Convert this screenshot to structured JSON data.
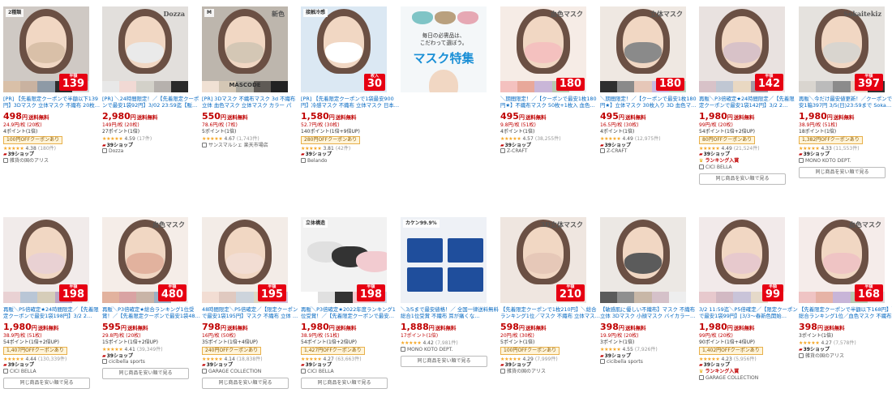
{
  "labels": {
    "ship_free": "送料無料",
    "yen": "円",
    "badge_39": "39ショップ",
    "rank_in": "ランキング入賞",
    "same_button": "同じ商品を安い順で見る"
  },
  "colors": {
    "accent_red": "#bf0000",
    "link_blue": "#0066c0",
    "star": "#f5a623"
  },
  "items": [
    {
      "title": "[PR] 【先着限定クーポンで半額以下139円】3Dマスク 立体マスク 不織布 20枚…",
      "price": "498",
      "unit": "24.9円/枚 (20枚)",
      "points": "4ポイント(1倍)",
      "coupon": "100円OFFクーポンあり",
      "stars": "★★★★★",
      "rating": "4.38",
      "reviews": "(180件)",
      "ship39": true,
      "rank": false,
      "shop": "雑貨の国のアリス",
      "same": false,
      "thumb": {
        "style": "woman",
        "hair": "#5b4034",
        "mask": "#d9c0a8",
        "bg": "#cfc9c4",
        "strip": [
          "#d9c0a8",
          "#c9b2a0",
          "#8e9aa6",
          "#2d2d2d",
          "#d7d7d7"
        ],
        "badge_top": "2種類",
        "brand": "",
        "caption": "",
        "price_badge": "139",
        "price_small": "半額"
      }
    },
    {
      "title": "[PR] ＼24時間限定！／【先着限定クーポンで最安1袋92円】3/02 23:59迄【販…",
      "price": "2,980",
      "unit": "149円/枚 (20枚)",
      "points": "27ポイント(1倍)",
      "coupon": "",
      "stars": "★★★★★",
      "rating": "4.59",
      "reviews": "(17件)",
      "ship39": true,
      "rank": false,
      "shop": "Dozza",
      "same": false,
      "thumb": {
        "style": "woman",
        "hair": "#3b2e2a",
        "mask": "#eaeaea",
        "bg": "#e2dfdc",
        "strip": [
          "#e8e8e8",
          "#f1d9d4",
          "#d3d1c9",
          "#b6b1ad",
          "#2a2a2a"
        ],
        "badge_top": "",
        "brand": "Dozza",
        "caption": "",
        "price_badge": "",
        "price_small": ""
      }
    },
    {
      "title": "[PR] 3Dマスク 不織布マスク 3d 不織布 立体 血色マスク 立体マスク カラー パー…",
      "price": "550",
      "unit": "78.6円/枚 (7枚)",
      "points": "5ポイント(1倍)",
      "coupon": "",
      "stars": "★★★★★",
      "rating": "4.67",
      "reviews": "(1,743件)",
      "ship39": false,
      "rank": false,
      "shop": "サンスマルシェ 楽天市場店",
      "same": false,
      "thumb": {
        "style": "woman",
        "hair": "#2e2320",
        "mask": "#d4c7b5",
        "bg": "#bdb6ad",
        "strip": [
          "#f0e1d4",
          "#d4c7b5",
          "#a7a49b",
          "#5f5a55",
          "#222"
        ],
        "badge_top": "M",
        "brand": "新色",
        "caption": "MASCODE",
        "price_badge": "",
        "price_small": ""
      }
    },
    {
      "title": "[PR] 【先着限定クーポンで1袋最安900円】冷感マスク 不織布 立体マスク 日本…",
      "price": "1,580",
      "unit": "52.7円/枚 (30枚)",
      "points": "140ポイント(1倍+9倍UP)",
      "coupon": "280円OFFクーポンあり",
      "stars": "★★★★★",
      "rating": "3.81",
      "reviews": "(42件)",
      "ship39": true,
      "rank": false,
      "shop": "Belando",
      "same": false,
      "thumb": {
        "style": "woman",
        "hair": "#2b2b2b",
        "mask": "#ffffff",
        "bg": "#dbe8f3",
        "strip": [],
        "badge_top": "接触冷感",
        "brand": "",
        "caption": "",
        "price_badge": "30",
        "price_small": "枚入"
      }
    },
    {
      "title": "",
      "price": "",
      "unit": "",
      "points": "",
      "coupon": "",
      "stars": "",
      "rating": "",
      "reviews": "",
      "ship39": false,
      "rank": false,
      "shop": "",
      "same": false,
      "feature": {
        "sub": "毎日の必需品は、\nこだわって選ぼう。",
        "title": "マスク特集"
      },
      "thumb": {
        "style": "feature",
        "hair": "#3a2e2a",
        "mask": "#ffffff",
        "bg": "#f4f7f9",
        "strip": [],
        "badge_top": "",
        "brand": "",
        "caption": "",
        "price_badge": "",
        "price_small": ""
      }
    },
    {
      "title": "＼期間限定！／【クーポンで最安1枚180円★】不織布マスク 50枚+1枚入 血色…",
      "price": "495",
      "unit": "9.8円/枚 (51枚)",
      "points": "4ポイント(1倍)",
      "coupon": "",
      "stars": "★★★★★",
      "rating": "4.57",
      "reviews": "(38,255件)",
      "ship39": true,
      "rank": false,
      "shop": "Z-CRAFT",
      "same": false,
      "thumb": {
        "style": "woman",
        "hair": "#4a3a32",
        "mask": "#f4c1bf",
        "bg": "#f6ece6",
        "strip": [
          "#f4c1bf",
          "#e8a89a",
          "#c9b6d8",
          "#b8c8b0",
          "#eee"
        ],
        "badge_top": "",
        "brand": "血色マスク",
        "caption": "",
        "price_badge": "180",
        "price_small": ""
      }
    },
    {
      "title": "＼期間限定！／【クーポンで最安1枚180円★】立体マスク 30枚入り 3D 血色マ…",
      "price": "495",
      "unit": "16.5円/枚 (30枚)",
      "points": "4ポイント(1倍)",
      "coupon": "",
      "stars": "★★★★★",
      "rating": "4.49",
      "reviews": "(12,975件)",
      "ship39": true,
      "rank": false,
      "shop": "Z-CRAFT",
      "same": false,
      "thumb": {
        "style": "woman",
        "hair": "#3a2a22",
        "mask": "#8a8a8a",
        "bg": "#efe8e2",
        "strip": [
          "#2f2f2f",
          "#8a8a8a",
          "#e6c7b8",
          "#c7b9e0",
          "#b6d3c2"
        ],
        "badge_top": "",
        "brand": "立体マスク",
        "caption": "",
        "price_badge": "180",
        "price_small": ""
      }
    },
    {
      "title": "再販＼P3倍確定★24時間限定／【先着限定クーポンで最安1袋142円】3/2 2…",
      "price": "1,980",
      "unit": "99円/枚 (20枚)",
      "points": "54ポイント(1倍+2倍UP)",
      "coupon": "80円OFFクーポンあり",
      "stars": "★★★★★",
      "rating": "4.49",
      "reviews": "(21,524件)",
      "ship39": true,
      "rank": true,
      "shop": "CICI BELLA",
      "same": true,
      "thumb": {
        "style": "woman",
        "hair": "#3d2d27",
        "mask": "#d8c2c8",
        "bg": "#e9e2e0",
        "strip": [
          "#d8c2c8",
          "#c0c7d3",
          "#e9d8c2",
          "#a29aa5",
          "#f3e6e6"
        ],
        "badge_top": "",
        "brand": "",
        "caption": "",
        "price_badge": "142",
        "price_small": "半額"
      }
    },
    {
      "title": "再販＼今だけ最安値更新！／クーポンで最安1箱397円 3/5(日)23:59まで Soka…",
      "price": "1,980",
      "unit": "38.9円/枚 (51枚)",
      "points": "18ポイント(1倍)",
      "coupon": "1,382円OFFクーポンあり",
      "stars": "★★★★★",
      "rating": "4.33",
      "reviews": "(11,553件)",
      "ship39": true,
      "rank": false,
      "shop": "MONO KOTO DEPT.",
      "same": true,
      "thumb": {
        "style": "woman",
        "hair": "#2e2622",
        "mask": "#d9d5cf",
        "bg": "#e5e2de",
        "strip": [
          "#d9d5cf",
          "#bbb",
          "#8b8b8b",
          "#e7cfc2",
          "#333"
        ],
        "badge_top": "",
        "brand": "Sokaitekiz",
        "caption": "",
        "price_badge": "397",
        "price_small": "半額"
      }
    },
    {
      "title": "再販＼P5倍確定★24時間限定／【先着限定クーポンで最安1袋198円】3/2 2…",
      "price": "1,980",
      "unit": "38.9円/枚 (51枚)",
      "points": "54ポイント(1倍+2倍UP)",
      "coupon": "1,407円OFFクーポンあり",
      "stars": "★★★★★",
      "rating": "4.44",
      "reviews": "(130,339件)",
      "ship39": true,
      "rank": false,
      "shop": "CICI BELLA",
      "same": true,
      "thumb": {
        "style": "woman",
        "hair": "#3a2a22",
        "mask": "#e9d1d3",
        "bg": "#f1ebea",
        "strip": [
          "#e9d1d3",
          "#b9c6d6",
          "#d6cdb9",
          "#bca6c4",
          "#f0efee"
        ],
        "badge_top": "",
        "brand": "",
        "caption": "",
        "price_badge": "198",
        "price_small": "半額"
      }
    },
    {
      "title": "再販＼P3倍確定★総合ランキング1位受賞！／【先着限定クーポンで最安1袋48…",
      "price": "595",
      "unit": "29.8円/枚 (20枚)",
      "points": "15ポイント(1倍+2倍UP)",
      "coupon": "",
      "stars": "★★★★★",
      "rating": "4.41",
      "reviews": "(39,349件)",
      "ship39": true,
      "rank": false,
      "shop": "cicibella sports",
      "same": true,
      "thumb": {
        "style": "woman",
        "hair": "#4a3a32",
        "mask": "#e2b29e",
        "bg": "#f5ede8",
        "strip": [
          "#e2b29e",
          "#d9a3a3",
          "#c9b4a7",
          "#9bb0c4",
          "#eee"
        ],
        "badge_top": "",
        "brand": "血色マスク",
        "caption": "",
        "price_badge": "480",
        "price_small": "半額"
      }
    },
    {
      "title": "48時間限定＼P5倍確定／【限定クーポンで最安1袋195円】マスク 不織布 立体 …",
      "price": "798",
      "unit": "16円/枚 (50枚)",
      "points": "35ポイント(1倍+4倍UP)",
      "coupon": "240円OFFクーポンあり",
      "stars": "★★★★★",
      "rating": "4.14",
      "reviews": "(18,838件)",
      "ship39": true,
      "rank": false,
      "shop": "GARAGE COLLECTION",
      "same": true,
      "thumb": {
        "style": "woman",
        "hair": "#7a5a48",
        "mask": "#f2ddd3",
        "bg": "#f3ece7",
        "strip": [
          "#f2ddd3",
          "#e0c9c0",
          "#cdd4dc",
          "#ddd8c4",
          "#d6c1d9"
        ],
        "badge_top": "",
        "brand": "",
        "caption": "",
        "price_badge": "195",
        "price_small": "半額"
      }
    },
    {
      "title": "再販＼P3倍確定★2022年度ランキング1位受賞！／【先着限定クーポンで最安…",
      "price": "1,980",
      "unit": "38.9円/枚 (51枚)",
      "points": "54ポイント(1倍+2倍UP)",
      "coupon": "1,427円OFFクーポンあり",
      "stars": "★★★★★",
      "rating": "4.27",
      "reviews": "(63,663件)",
      "ship39": true,
      "rank": false,
      "shop": "CICI BELLA",
      "same": true,
      "thumb": {
        "style": "product",
        "hair": "#333",
        "mask": "#ffffff",
        "bg": "#f2f2f2",
        "strip": [
          "#fff",
          "#e0e0e0",
          "#333",
          "#f2cbd0",
          "#cfd8e6"
        ],
        "badge_top": "立体構造",
        "brand": "",
        "caption": "",
        "price_badge": "198",
        "price_small": "半額"
      }
    },
    {
      "title": "＼3/5まで最安値格！／ 全国一律送料無料 総合1位受賞 不織布 耳が痛くな…",
      "price": "1,888",
      "unit": "17ポイント(1倍)",
      "points": "",
      "coupon": "",
      "stars": "★★★★★",
      "rating": "4.42",
      "reviews": "(7,981件)",
      "ship39": false,
      "rank": false,
      "shop": "MONO KOTO DEPT.",
      "same": true,
      "thumb": {
        "style": "boxes",
        "hair": "#333",
        "mask": "#1f4e9c",
        "bg": "#eef1f6",
        "strip": [],
        "badge_top": "カケン99.9%",
        "brand": "",
        "caption": "",
        "price_badge": "",
        "price_small": ""
      }
    },
    {
      "title": "【先着限定クーポンで1枚210円】＼総合ランキング1位／マスク 不織布 立体マス…",
      "price": "598",
      "unit": "20円/枚 (30枚)",
      "points": "5ポイント(1倍)",
      "coupon": "100円OFFクーポンあり",
      "stars": "★★★★★",
      "rating": "4.29",
      "reviews": "(7,999件)",
      "ship39": true,
      "rank": false,
      "shop": "雑貨の国のアリス",
      "same": false,
      "thumb": {
        "style": "woman",
        "hair": "#4e3b32",
        "mask": "#e6c8b8",
        "bg": "#efe6e0",
        "strip": [],
        "badge_top": "",
        "brand": "3D立体マスク",
        "caption": "",
        "price_badge": "210",
        "price_small": "半額"
      }
    },
    {
      "title": "【敏感肌に優しい不織布】マスク 不織布 立体 3Dマスク 小顔マスク バイカラー…",
      "price": "398",
      "unit": "19.9円/枚 (20枚)",
      "points": "3ポイント(1倍)",
      "coupon": "",
      "stars": "★★★★★",
      "rating": "4.55",
      "reviews": "(7,926件)",
      "ship39": true,
      "rank": false,
      "shop": "cicibella sports",
      "same": false,
      "thumb": {
        "style": "woman",
        "hair": "#2e2420",
        "mask": "#5b5b5b",
        "bg": "#ece8e4",
        "strip": [
          "#5b5b5b",
          "#8f8f8f",
          "#c8b7a7",
          "#d5c1c9",
          "#eee"
        ],
        "badge_top": "",
        "brand": "",
        "caption": "",
        "price_badge": "",
        "price_small": ""
      }
    },
    {
      "title": "3/2 11:59迄＼P5倍確定／【限定クーポンで最安1袋99円】[3/3〜春新色開始…",
      "price": "1,980",
      "unit": "99円/枚 (20枚)",
      "points": "90ポイント(1倍+4倍UP)",
      "coupon": "1,402円OFFクーポンあり",
      "stars": "★★★★★",
      "rating": "4.23",
      "reviews": "(5,956件)",
      "ship39": true,
      "rank": true,
      "shop": "GARAGE COLLECTION",
      "same": false,
      "thumb": {
        "style": "woman",
        "hair": "#3d2d27",
        "mask": "#e7c9cd",
        "bg": "#f2eaea",
        "strip": [
          "#e7c9cd",
          "#d2b9c3",
          "#c9c4d9",
          "#e5d9c9",
          "#fff"
        ],
        "badge_top": "",
        "brand": "",
        "caption": "",
        "price_badge": "99",
        "price_small": "半額"
      }
    },
    {
      "title": "【先着限定クーポンで半額以下168円】＼総合ランキング1位／血色マスク 不織布…",
      "price": "398",
      "unit": "",
      "points": "3ポイント(1倍)",
      "coupon": "",
      "stars": "★★★★★",
      "rating": "4.27",
      "reviews": "(7,578件)",
      "ship39": true,
      "rank": false,
      "shop": "雑貨の国のアリス",
      "same": false,
      "thumb": {
        "style": "woman",
        "hair": "#4a3a32",
        "mask": "#efc4c4",
        "bg": "#f5ecea",
        "strip": [
          "#efc4c4",
          "#e6b3a6",
          "#c8b5d8",
          "#b6c8b0",
          "#ddd"
        ],
        "badge_top": "",
        "brand": "血色マスク",
        "caption": "",
        "price_badge": "168",
        "price_small": "半額"
      }
    }
  ]
}
